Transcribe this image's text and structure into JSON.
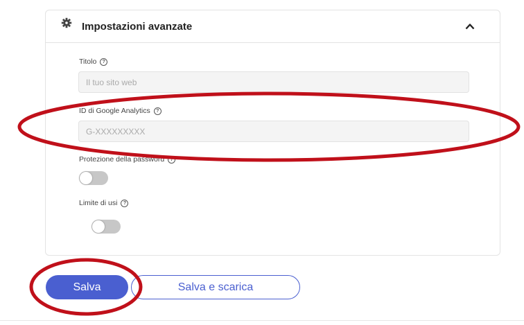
{
  "advanced_settings": {
    "title": "Impostazioni avanzate",
    "header_icon": "gear-icon",
    "collapse_icon": "chevron-up-icon",
    "fields": {
      "title": {
        "label": "Titolo",
        "placeholder": "Il tuo sito web",
        "value": ""
      },
      "analytics": {
        "label": "ID di Google Analytics",
        "placeholder": "G-XXXXXXXXX",
        "value": ""
      },
      "password": {
        "label": "Protezione della password",
        "enabled": false
      },
      "usage_limit": {
        "label": "Limite di usi",
        "enabled": false
      }
    },
    "help_glyph": "?"
  },
  "actions": {
    "save_label": "Salva",
    "save_download_label": "Salva e scarica"
  },
  "colors": {
    "primary": "#4a5fd0",
    "annotation": "#c0101a",
    "toggle_off": "#c7c7c7"
  }
}
